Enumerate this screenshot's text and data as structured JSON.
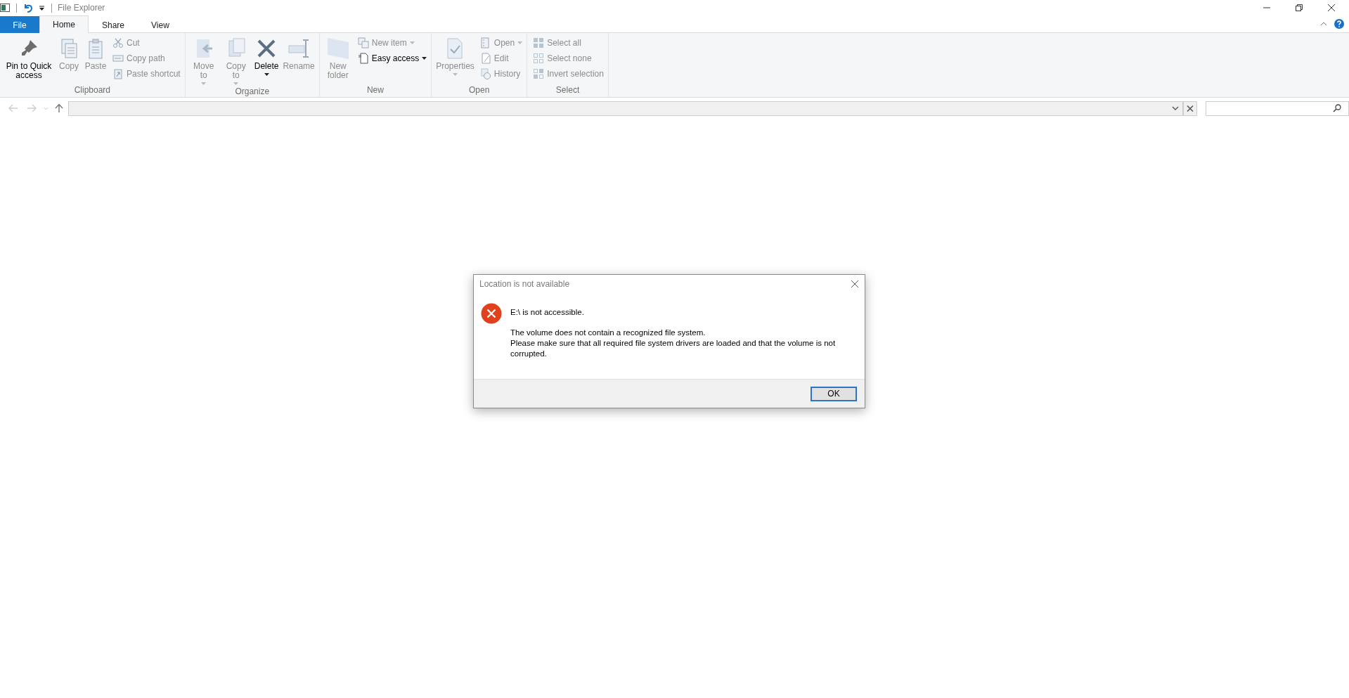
{
  "window": {
    "title": "File Explorer"
  },
  "tabs": [
    {
      "label": "File",
      "kind": "file",
      "selected": false
    },
    {
      "label": "Home",
      "kind": "tab",
      "selected": true
    },
    {
      "label": "Share",
      "kind": "tab",
      "selected": false
    },
    {
      "label": "View",
      "kind": "tab",
      "selected": false
    }
  ],
  "ribbon": {
    "groups": [
      {
        "label": "Clipboard",
        "items": [
          {
            "kind": "large",
            "label": "Pin to Quick access",
            "disabled": false,
            "dropdown": false
          },
          {
            "kind": "large",
            "label": "Copy",
            "disabled": true,
            "dropdown": false
          },
          {
            "kind": "large",
            "label": "Paste",
            "disabled": true,
            "dropdown": false
          },
          {
            "kind": "small",
            "label": "Cut",
            "disabled": true,
            "dropdown": false
          },
          {
            "kind": "small",
            "label": "Copy path",
            "disabled": true,
            "dropdown": false
          },
          {
            "kind": "small",
            "label": "Paste shortcut",
            "disabled": true,
            "dropdown": false
          }
        ]
      },
      {
        "label": "Organize",
        "items": [
          {
            "kind": "large",
            "label": "Move to",
            "disabled": true,
            "dropdown": true
          },
          {
            "kind": "large",
            "label": "Copy to",
            "disabled": true,
            "dropdown": true
          },
          {
            "kind": "large",
            "label": "Delete",
            "disabled": false,
            "dropdown": true
          },
          {
            "kind": "large",
            "label": "Rename",
            "disabled": true,
            "dropdown": false
          }
        ]
      },
      {
        "label": "New",
        "items": [
          {
            "kind": "large",
            "label": "New folder",
            "disabled": true,
            "dropdown": false
          },
          {
            "kind": "small",
            "label": "New item",
            "disabled": true,
            "dropdown": true
          },
          {
            "kind": "small",
            "label": "Easy access",
            "disabled": false,
            "dropdown": true
          }
        ]
      },
      {
        "label": "Open",
        "items": [
          {
            "kind": "large",
            "label": "Properties",
            "disabled": true,
            "dropdown": true
          },
          {
            "kind": "small",
            "label": "Open",
            "disabled": true,
            "dropdown": true
          },
          {
            "kind": "small",
            "label": "Edit",
            "disabled": true,
            "dropdown": false
          },
          {
            "kind": "small",
            "label": "History",
            "disabled": true,
            "dropdown": false
          }
        ]
      },
      {
        "label": "Select",
        "items": [
          {
            "kind": "small",
            "label": "Select all",
            "disabled": true,
            "dropdown": false
          },
          {
            "kind": "small",
            "label": "Select none",
            "disabled": true,
            "dropdown": false
          },
          {
            "kind": "small",
            "label": "Invert selection",
            "disabled": true,
            "dropdown": false
          }
        ]
      }
    ]
  },
  "navigation": {
    "back_disabled": true,
    "forward_disabled": true
  },
  "dialog": {
    "title": "Location is not available",
    "heading": "E:\\ is not accessible.",
    "message": [
      "The volume does not contain a recognized file system.",
      "Please make sure that all required file system drivers are loaded and that the volume is not corrupted."
    ],
    "buttons": [
      "OK"
    ]
  }
}
